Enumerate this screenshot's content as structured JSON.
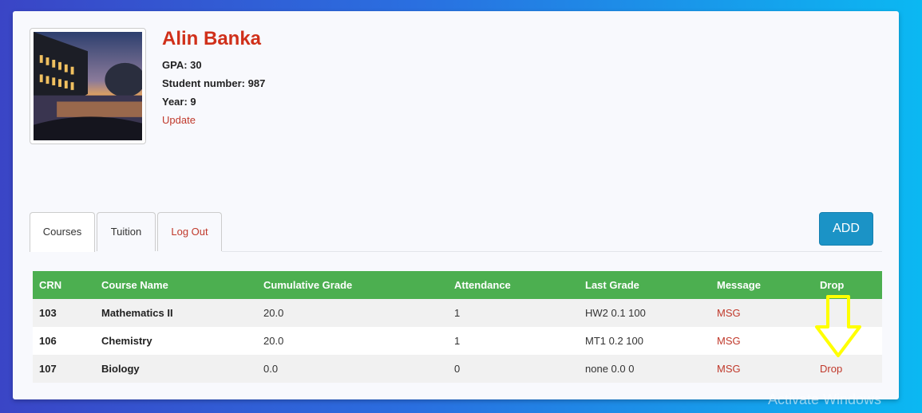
{
  "profile": {
    "name": "Alin Banka",
    "gpa": "GPA: 30",
    "student_number": "Student number: 987",
    "year": "Year: 9",
    "update_label": "Update"
  },
  "tabs": [
    {
      "label": "Courses"
    },
    {
      "label": "Tuition"
    },
    {
      "label": "Log Out"
    }
  ],
  "add_label": "ADD",
  "table": {
    "headers": [
      "CRN",
      "Course Name",
      "Cumulative Grade",
      "Attendance",
      "Last Grade",
      "Message",
      "Drop"
    ],
    "rows": [
      {
        "crn": "103",
        "course": "Mathematics II",
        "grade": "20.0",
        "attendance": "1",
        "last_grade": "HW2 0.1 100",
        "message": "MSG",
        "drop": ""
      },
      {
        "crn": "106",
        "course": "Chemistry",
        "grade": "20.0",
        "attendance": "1",
        "last_grade": "MT1 0.2 100",
        "message": "MSG",
        "drop": ""
      },
      {
        "crn": "107",
        "course": "Biology",
        "grade": "0.0",
        "attendance": "0",
        "last_grade": "none 0.0 0",
        "message": "MSG",
        "drop": "Drop"
      }
    ]
  },
  "watermark": "Activate Windows",
  "colors": {
    "accent_red": "#d0301a",
    "header_green": "#4caf50",
    "add_blue": "#1b93c6",
    "arrow_yellow": "#ffff00"
  }
}
